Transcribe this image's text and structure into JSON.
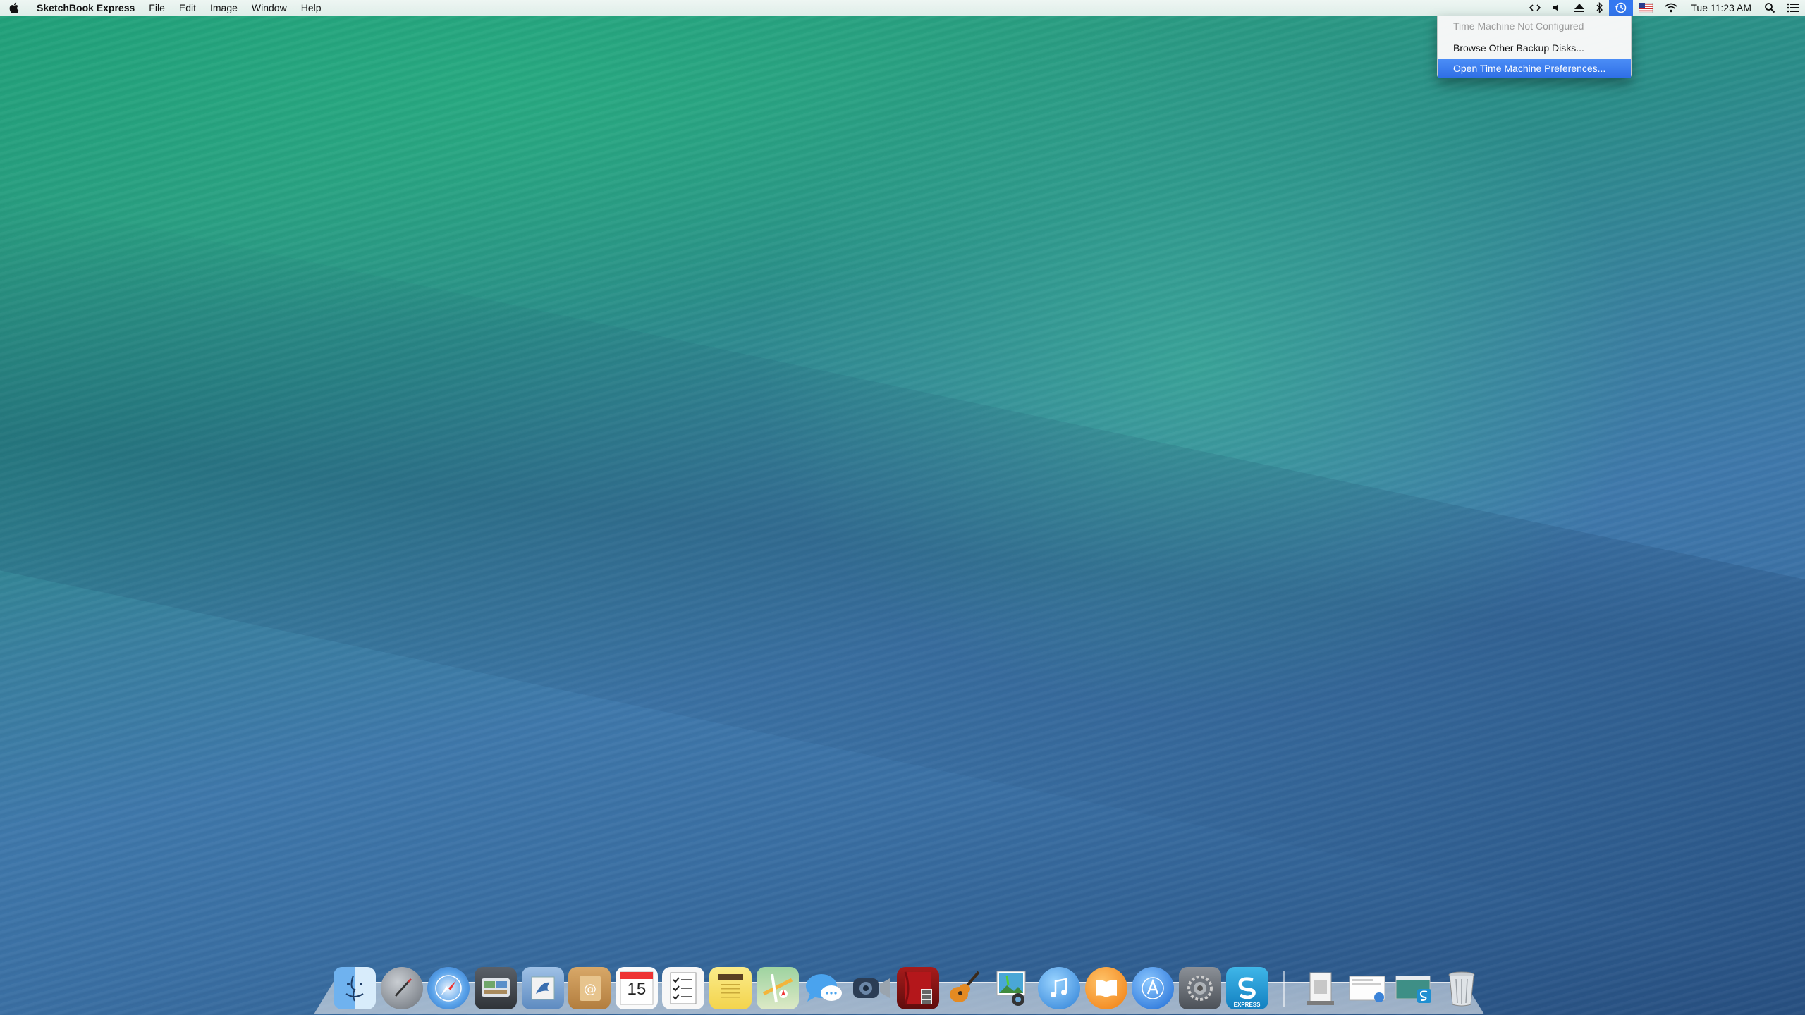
{
  "menubar": {
    "app_name": "SketchBook Express",
    "menus": [
      "File",
      "Edit",
      "Image",
      "Window",
      "Help"
    ],
    "clock": "Tue 11:23 AM"
  },
  "time_machine_menu": {
    "items": [
      {
        "label": "Time Machine Not Configured",
        "state": "disabled"
      },
      {
        "label": "Browse Other Backup Disks...",
        "state": "normal"
      },
      {
        "label": "Open Time Machine Preferences...",
        "state": "selected"
      }
    ]
  },
  "dock": {
    "apps": [
      {
        "name": "finder-icon"
      },
      {
        "name": "launchpad-icon"
      },
      {
        "name": "safari-icon"
      },
      {
        "name": "image-capture-icon"
      },
      {
        "name": "mail-icon"
      },
      {
        "name": "contacts-icon"
      },
      {
        "name": "calendar-icon",
        "text": "15"
      },
      {
        "name": "reminders-icon"
      },
      {
        "name": "notes-icon"
      },
      {
        "name": "maps-icon"
      },
      {
        "name": "messages-icon"
      },
      {
        "name": "facetime-icon"
      },
      {
        "name": "photo-booth-icon"
      },
      {
        "name": "garageband-icon"
      },
      {
        "name": "iphoto-icon"
      },
      {
        "name": "itunes-icon"
      },
      {
        "name": "ibooks-icon"
      },
      {
        "name": "app-store-icon"
      },
      {
        "name": "system-preferences-icon"
      },
      {
        "name": "sketchbook-express-icon",
        "text": "EXPRESS"
      }
    ],
    "others": [
      {
        "name": "documents-stack-icon"
      },
      {
        "name": "downloads-stack-icon"
      },
      {
        "name": "screenshot-stack-icon"
      },
      {
        "name": "trash-icon"
      }
    ]
  },
  "colors": {
    "menu_highlight": "#3478f0",
    "selection": "#2f6fe6"
  }
}
